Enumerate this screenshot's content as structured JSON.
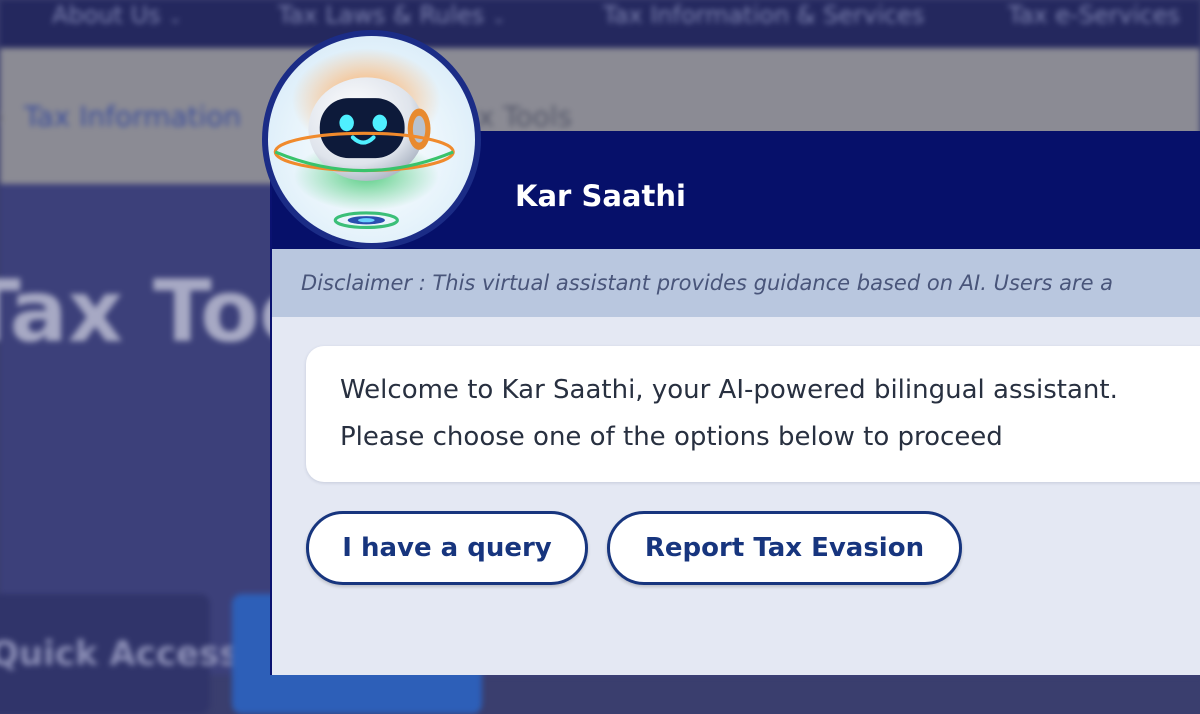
{
  "background": {
    "nav_items": [
      {
        "label": "About Us",
        "has_caret": true
      },
      {
        "label": "Tax Laws & Rules",
        "has_caret": true
      },
      {
        "label": "Tax Information & Services",
        "has_caret": false
      },
      {
        "label": "Tax e-Services",
        "has_caret": false
      }
    ],
    "breadcrumb": {
      "items": [
        "Tax Information",
        "Tax Tools"
      ]
    },
    "hero_title": "Tax Tools",
    "cards": [
      "Quick Access",
      ""
    ]
  },
  "chat": {
    "title": "Kar Saathi",
    "avatar_icon": "robot-icon",
    "disclaimer": "Disclaimer : This virtual assistant provides guidance based on AI. Users are a",
    "welcome_lines": [
      "Welcome to Kar Saathi, your AI-powered bilingual assistant.",
      "Please choose one of the options below to proceed"
    ],
    "options": [
      {
        "label": "I have a query"
      },
      {
        "label": "Report Tax Evasion"
      }
    ]
  },
  "colors": {
    "header": "#06106a",
    "disclaimer_bg": "#b9c7df",
    "panel_bg": "#e4e8f3",
    "button_border": "#17357e",
    "nav_bg": "#24285e"
  }
}
